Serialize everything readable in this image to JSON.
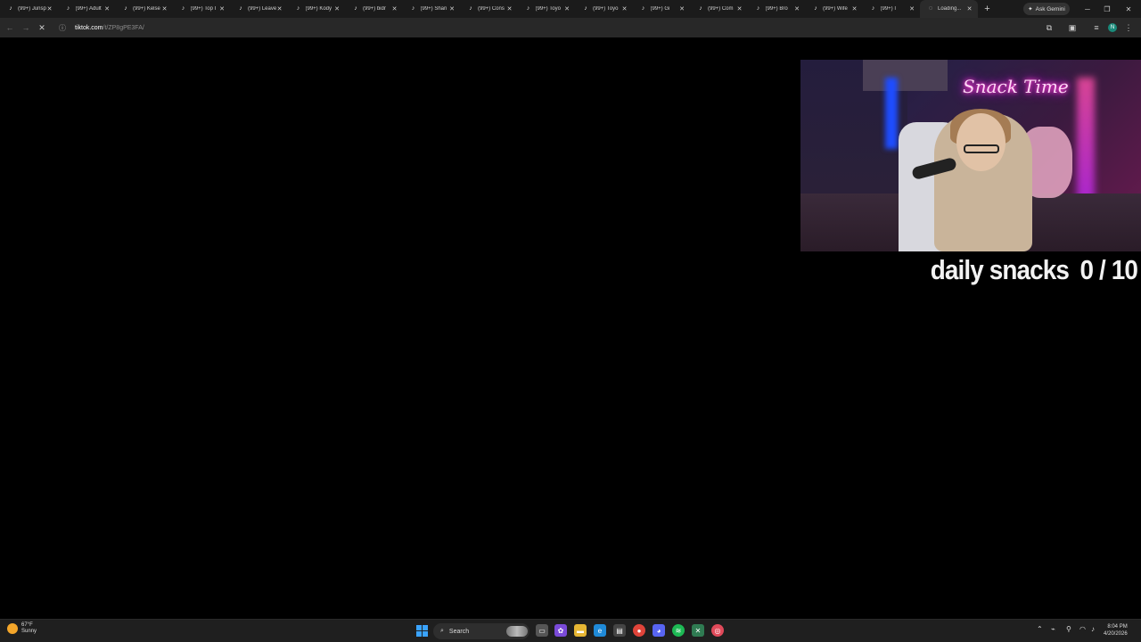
{
  "browser": {
    "tabs": [
      {
        "label": "(99+) Junsp",
        "icon": "tiktok-icon"
      },
      {
        "label": "(99+) Adult",
        "icon": "tiktok-icon"
      },
      {
        "label": "(99+) Kelse",
        "icon": "tiktok-icon"
      },
      {
        "label": "(99+) Top I",
        "icon": "tiktok-icon"
      },
      {
        "label": "(99+) Leave",
        "icon": "tiktok-icon"
      },
      {
        "label": "(99+) Kody",
        "icon": "tiktok-icon"
      },
      {
        "label": "(99+) bidr",
        "icon": "tiktok-icon"
      },
      {
        "label": "(99+) Shari",
        "icon": "tiktok-icon"
      },
      {
        "label": "(99+) Cons",
        "icon": "tiktok-icon"
      },
      {
        "label": "(99+) Toyo",
        "icon": "tiktok-icon"
      },
      {
        "label": "(99+) Toyo",
        "icon": "tiktok-icon"
      },
      {
        "label": "(99+) Gi",
        "icon": "tiktok-icon"
      },
      {
        "label": "(99+) Com",
        "icon": "tiktok-icon"
      },
      {
        "label": "(99+) Bro",
        "icon": "tiktok-icon"
      },
      {
        "label": "(99+) Wife",
        "icon": "tiktok-icon"
      },
      {
        "label": "(99+) I",
        "icon": "tiktok-icon"
      },
      {
        "label": "Loading...",
        "icon": "loading-spinner-icon",
        "active": true
      }
    ],
    "gemini_label": "Ask Gemini",
    "address": {
      "domain": "tiktok.com",
      "path": "/t/ZP8gPE3FA/"
    }
  },
  "stream": {
    "neon_sign": "Snack Time",
    "counter": {
      "label": "daily snacks",
      "current": "0",
      "separator": "/",
      "total": "10"
    }
  },
  "taskbar": {
    "weather": {
      "temp": "67°F",
      "condition": "Sunny"
    },
    "search_label": "Search",
    "time": "8:04 PM",
    "date": "4/20/2026"
  }
}
